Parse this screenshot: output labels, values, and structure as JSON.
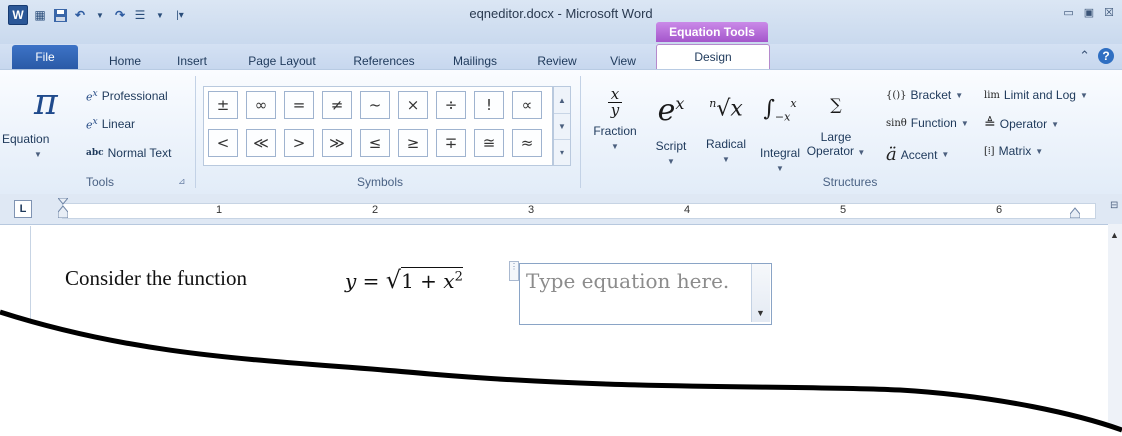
{
  "window": {
    "title": "eqneditor.docx - Microsoft Word",
    "contextual_tab_group": "Equation Tools",
    "controls": [
      "▭",
      "▣",
      "☒"
    ]
  },
  "qat": {
    "app_icon": "W",
    "items": [
      "save-icon",
      "undo-icon",
      "redo-icon",
      "bullets-icon"
    ]
  },
  "tabs": [
    "File",
    "Home",
    "Insert",
    "Page Layout",
    "References",
    "Mailings",
    "Review",
    "View",
    "Design"
  ],
  "active_tab": "Design",
  "tools": {
    "equation_label": "Equation",
    "professional": "Professional",
    "linear": "Linear",
    "normal_text": "Normal Text",
    "normal_text_prefix": "abc",
    "group_label": "Tools"
  },
  "symbols": {
    "row1": [
      "±",
      "∞",
      "=",
      "≠",
      "~",
      "×",
      "÷",
      "!",
      "∝"
    ],
    "row2": [
      "<",
      "≪",
      ">",
      "≫",
      "≤",
      "≥",
      "∓",
      "≅",
      "≈"
    ],
    "group_label": "Symbols"
  },
  "structures": {
    "fraction": "Fraction",
    "script": "Script",
    "radical": "Radical",
    "integral": "Integral",
    "large_operator_1": "Large",
    "large_operator_2": "Operator",
    "bracket": "Bracket",
    "function": "Function",
    "accent": "Accent",
    "limit_and_log": "Limit and Log",
    "operator": "Operator",
    "matrix": "Matrix",
    "group_label": "Structures",
    "bracket_icon": "{()}",
    "function_icon": "sinθ",
    "limit_icon": "lim",
    "accent_icon": "ä"
  },
  "ruler": {
    "numbers": [
      "1",
      "2",
      "3",
      "4",
      "5",
      "6"
    ],
    "tab_selector": "L"
  },
  "document": {
    "sentence": "Consider the function",
    "formula": "y = √1 + x²",
    "equation_placeholder": "Type equation here."
  },
  "colors": {
    "ribbon_tab_bar": "#c9d9ee",
    "file_tab": "#2a5aa7",
    "equation_tools": "#a456cb"
  }
}
